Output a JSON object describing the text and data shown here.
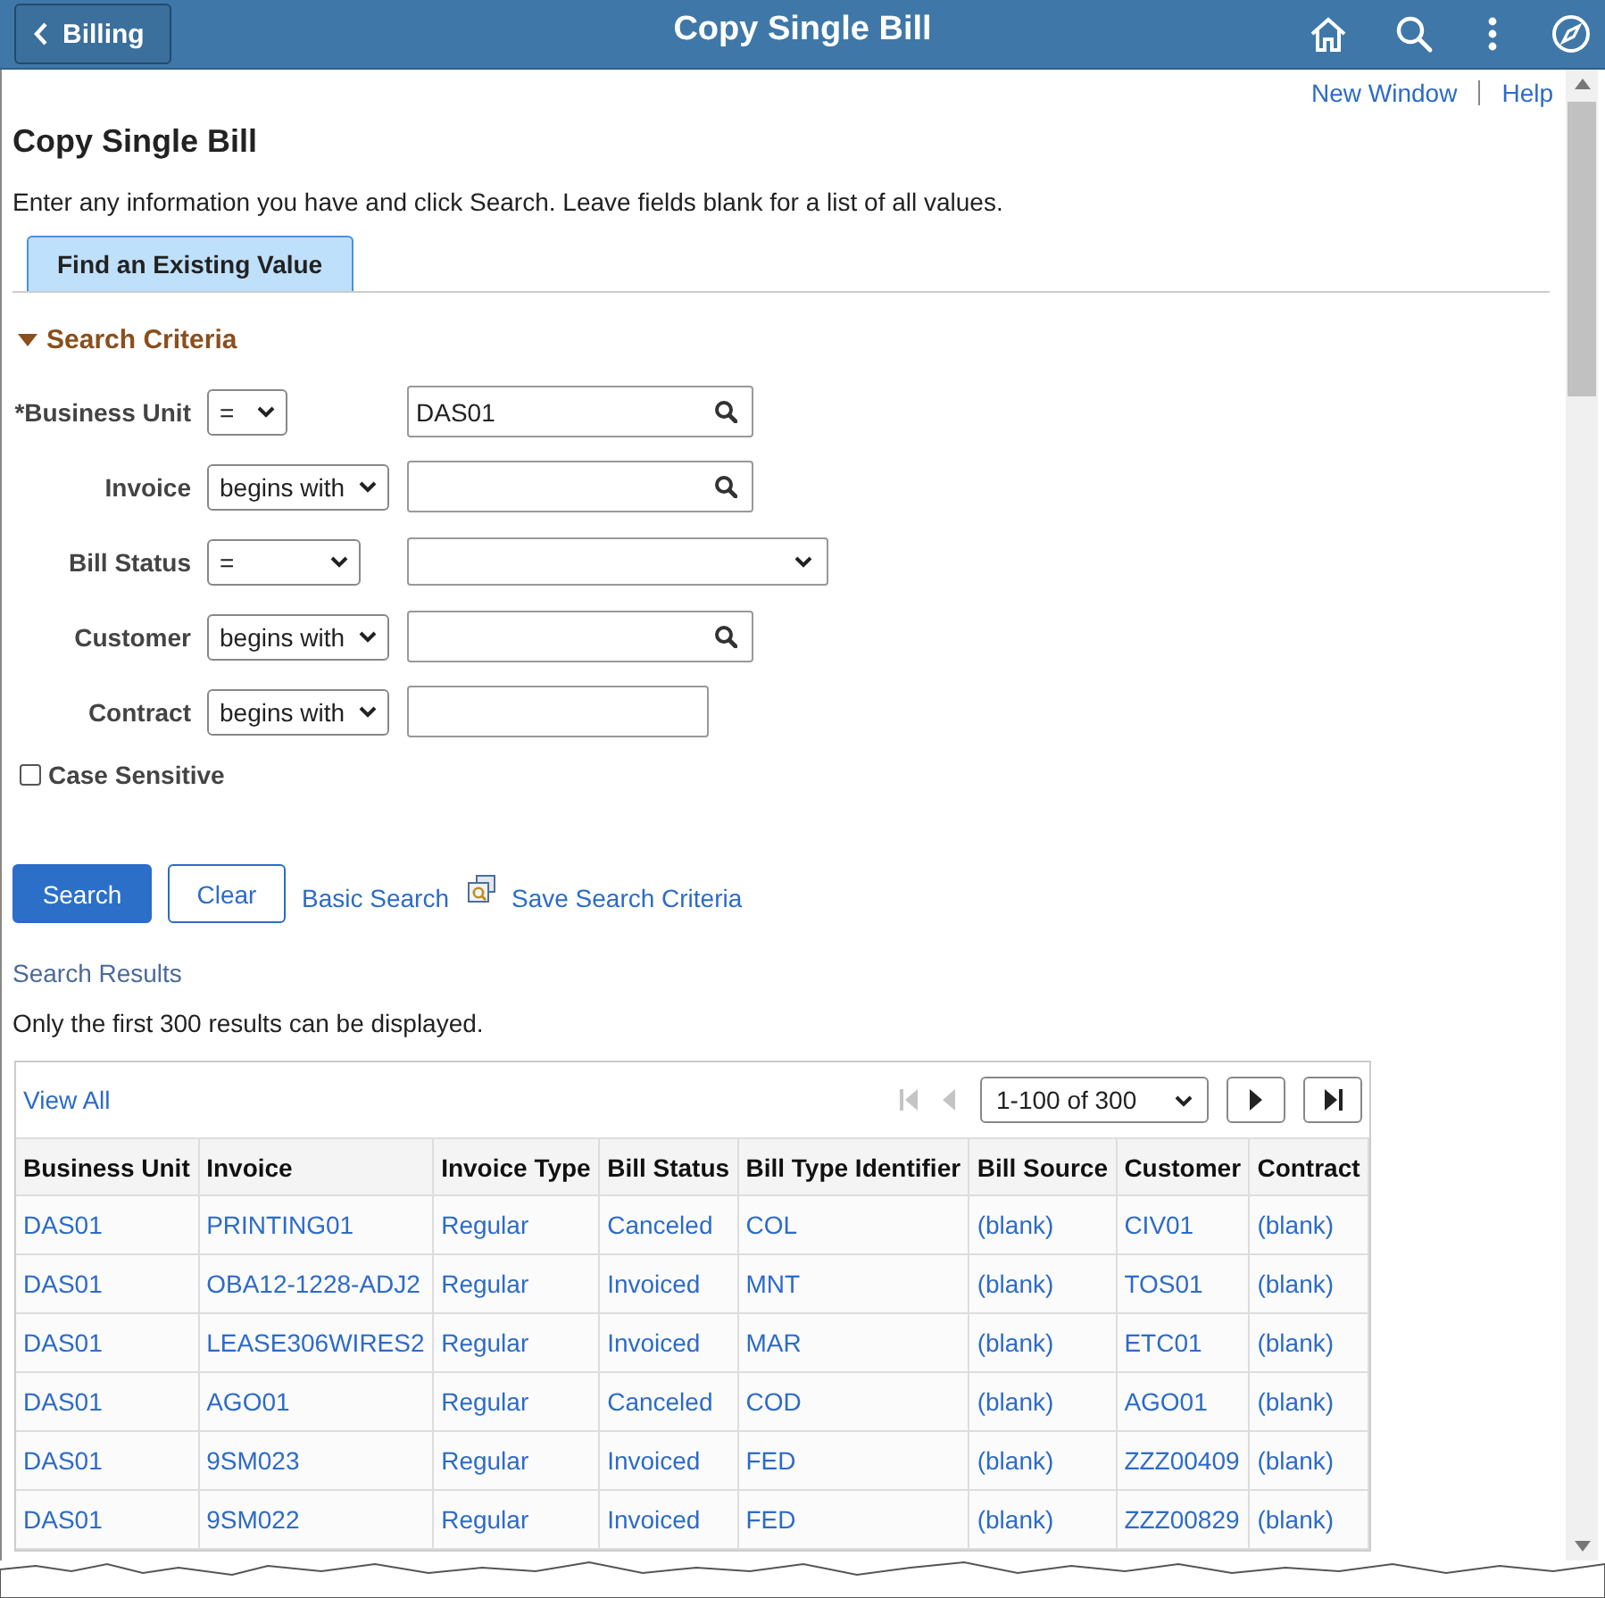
{
  "header": {
    "back_button": "Billing",
    "title": "Copy Single Bill"
  },
  "top_links": [
    "New Window",
    "Help"
  ],
  "page_title": "Copy Single Bill",
  "instructions": "Enter any information you have and click Search. Leave fields blank for a list of all values.",
  "tabs": [
    {
      "label": "Find an Existing Value",
      "selected": true
    }
  ],
  "search_criteria": {
    "title": "Search Criteria",
    "expanded": true,
    "fields": [
      {
        "label": "*Business Unit",
        "operator": "=",
        "kind": "lookup",
        "value": "DAS01"
      },
      {
        "label": "Invoice",
        "operator": "begins with",
        "kind": "lookup"
      },
      {
        "label": "Bill Status",
        "operator": "=",
        "kind": "dropdown"
      },
      {
        "label": "Customer",
        "operator": "begins with",
        "kind": "lookup"
      },
      {
        "label": "Contract",
        "operator": "begins with",
        "kind": "text"
      }
    ],
    "case_sensitive": {
      "label": "Case Sensitive",
      "checked": false
    }
  },
  "actions": {
    "search": "Search",
    "clear": "Clear",
    "basic_search": "Basic Search",
    "save_criteria": "Save Search Criteria"
  },
  "results": {
    "title": "Search Results",
    "note": "Only the first 300 results can be displayed.",
    "view_all": "View All",
    "page_range": "1-100 of 300",
    "pager": [
      {
        "kind": "first",
        "disabled": true
      },
      {
        "kind": "previous",
        "disabled": true
      },
      {
        "kind": "range"
      },
      {
        "kind": "next",
        "disabled": false
      },
      {
        "kind": "last",
        "disabled": false
      }
    ],
    "columns": [
      "Business Unit",
      "Invoice",
      "Invoice Type",
      "Bill Status",
      "Bill Type Identifier",
      "Bill Source",
      "Customer",
      "Contract"
    ],
    "rows": [
      [
        "DAS01",
        "PRINTING01",
        "Regular",
        "Canceled",
        "COL",
        "(blank)",
        "CIV01",
        "(blank)"
      ],
      [
        "DAS01",
        "OBA12-1228-ADJ2",
        "Regular",
        "Invoiced",
        "MNT",
        "(blank)",
        "TOS01",
        "(blank)"
      ],
      [
        "DAS01",
        "LEASE306WIRES2",
        "Regular",
        "Invoiced",
        "MAR",
        "(blank)",
        "ETC01",
        "(blank)"
      ],
      [
        "DAS01",
        "AGO01",
        "Regular",
        "Canceled",
        "COD",
        "(blank)",
        "AGO01",
        "(blank)"
      ],
      [
        "DAS01",
        "9SM023",
        "Regular",
        "Invoiced",
        "FED",
        "(blank)",
        "ZZZ00409",
        "(blank)"
      ],
      [
        "DAS01",
        "9SM022",
        "Regular",
        "Invoiced",
        "FED",
        "(blank)",
        "ZZZ00829",
        "(blank)"
      ]
    ]
  }
}
